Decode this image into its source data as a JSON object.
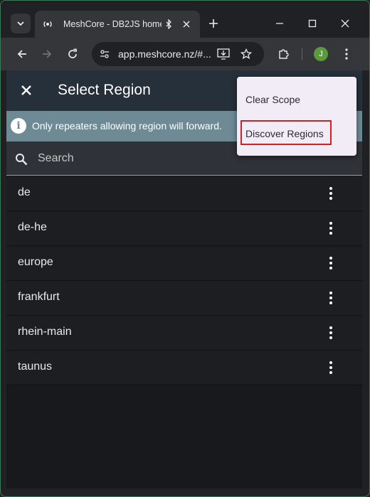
{
  "browser": {
    "tab_title": "MeshCore - DB2JS home",
    "url": "app.meshcore.nz/#...",
    "profile_initial": "J",
    "accent_border": "#3d7a55"
  },
  "app": {
    "title": "Select Region",
    "info_text": "Only repeaters allowing region will forward.",
    "search_placeholder": "Search",
    "regions": [
      "de",
      "de-he",
      "europe",
      "frankfurt",
      "rhein-main",
      "taunus"
    ]
  },
  "menu": {
    "items": [
      "Clear Scope",
      "Discover Regions"
    ],
    "highlighted": "Discover Regions",
    "highlight_color": "#d32027"
  }
}
